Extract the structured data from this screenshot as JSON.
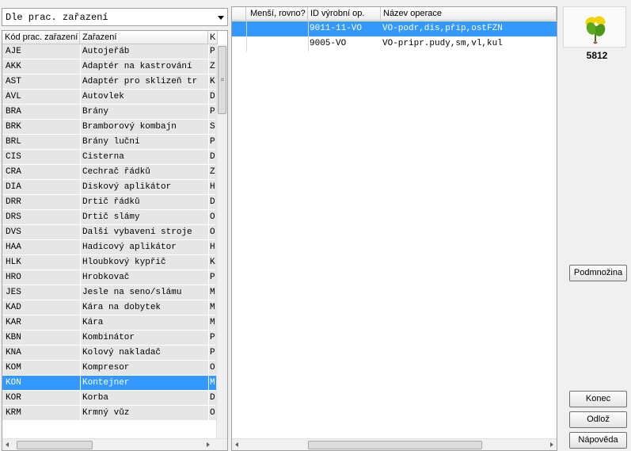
{
  "filter": {
    "selected": "Dle prac. zařazení"
  },
  "left_grid": {
    "columns": [
      "Kód prac. zařazení",
      "Zařazení",
      "K"
    ],
    "selected_index": 22,
    "rows": [
      {
        "code": "AJE",
        "name": "Autojeřáb",
        "k": "P"
      },
      {
        "code": "AKK",
        "name": "Adaptér na kastrování",
        "k": "Z"
      },
      {
        "code": "AST",
        "name": "Adaptér pro sklizeň tr",
        "k": "K"
      },
      {
        "code": "AVL",
        "name": "Autovlek",
        "k": "D"
      },
      {
        "code": "BRA",
        "name": "Brány",
        "k": "P"
      },
      {
        "code": "BRK",
        "name": "Bramborový kombajn",
        "k": "S"
      },
      {
        "code": "BRL",
        "name": "Brány luční",
        "k": "P"
      },
      {
        "code": "CIS",
        "name": "Cisterna",
        "k": "D"
      },
      {
        "code": "CRA",
        "name": "Čechrač řádků",
        "k": "Z"
      },
      {
        "code": "DIA",
        "name": "Diskový aplikátor",
        "k": "H"
      },
      {
        "code": "DRR",
        "name": "Drtič řádků",
        "k": "D"
      },
      {
        "code": "DRS",
        "name": "Drtič slámy",
        "k": "O"
      },
      {
        "code": "DVS",
        "name": "Další vybavení stroje",
        "k": "O"
      },
      {
        "code": "HAA",
        "name": "Hadicový aplikátor",
        "k": "H"
      },
      {
        "code": "HLK",
        "name": "Hloubkový kypřič",
        "k": "K"
      },
      {
        "code": "HRO",
        "name": "Hrobkovač",
        "k": "P"
      },
      {
        "code": "JES",
        "name": "Jesle na seno/slámu",
        "k": "M"
      },
      {
        "code": "KAD",
        "name": "Kára na dobytek",
        "k": "M"
      },
      {
        "code": "KAR",
        "name": "Kára",
        "k": "M"
      },
      {
        "code": "KBN",
        "name": "Kombinátor",
        "k": "P"
      },
      {
        "code": "KNA",
        "name": "Kolový nakladač",
        "k": "P"
      },
      {
        "code": "KOM",
        "name": "Kompresor",
        "k": "O"
      },
      {
        "code": "KON",
        "name": "Kontejner",
        "k": "M"
      },
      {
        "code": "KOR",
        "name": "Korba",
        "k": "D"
      },
      {
        "code": "KRM",
        "name": "Krmný vůz",
        "k": "O"
      }
    ]
  },
  "right_grid": {
    "columns": [
      "Menší, rovno?",
      "ID výrobní op.",
      "Název operace"
    ],
    "rows": [
      {
        "flag": "",
        "id": "9011-11-VO",
        "name": "VO-podr,dis,přip,ostFZN"
      },
      {
        "flag": "",
        "id": "9005-VO",
        "name": "VO-pripr.pudy,sm,vl,kul"
      }
    ]
  },
  "side": {
    "user_id": "5812",
    "logo_icon": "plant-leaf-logo",
    "subset_label": "Podmnožina",
    "end_label": "Konec",
    "defer_label": "Odlož",
    "help_label": "Nápověda"
  },
  "colors": {
    "selection": "#3399ff",
    "row_bg": "#e6e6e6"
  }
}
